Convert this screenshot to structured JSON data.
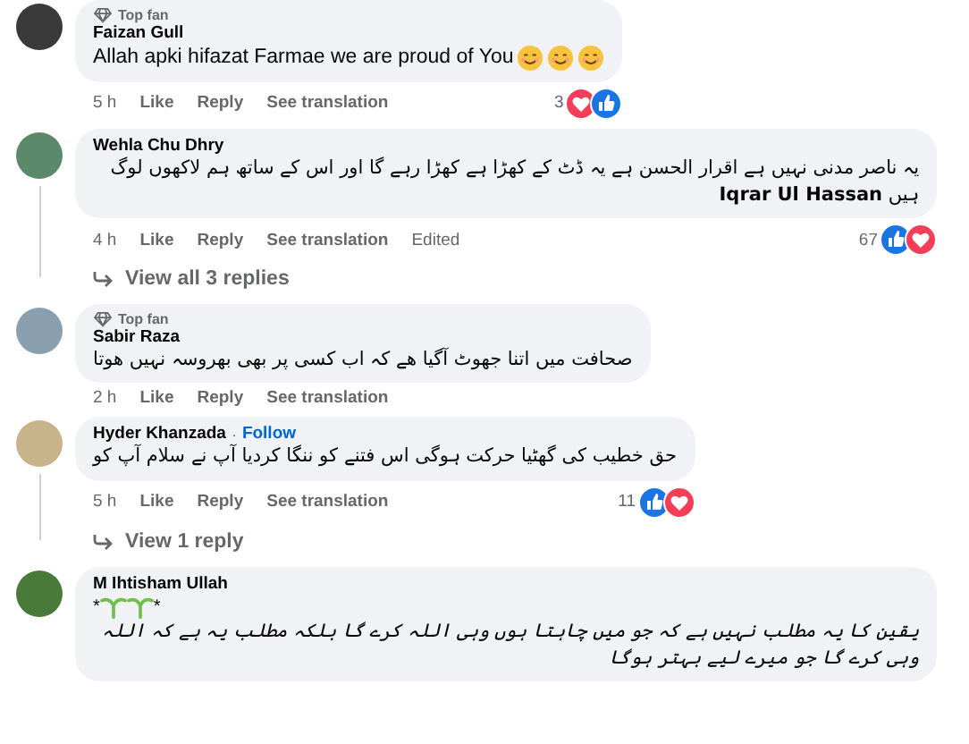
{
  "comments": [
    {
      "badge": "Top fan",
      "author": "Faizan Gull",
      "text": "Allah apki hifazat Farmae we are proud of You",
      "trailing_emoji": [
        {
          "kind": "smile"
        },
        {
          "kind": "smile"
        },
        {
          "kind": "smile"
        }
      ],
      "time": "5 h",
      "actions": [
        "Like",
        "Reply",
        "See translation"
      ],
      "reaction_count": "3",
      "reactions": [
        {
          "kind": "love"
        },
        {
          "kind": "like"
        }
      ]
    },
    {
      "author": "Wehla Chu Dhry",
      "text": "یہ ناصر مدنی نہیں ہے اقرار الحسن ہے یہ ڈٹ کے کھڑا ہے کھڑا رہے گا اور اس کے ساتھ ہم لاکھوں لوگ ہیں **Iqrar Ul Hassan**",
      "time": "4 h",
      "actions": [
        "Like",
        "Reply",
        "See translation"
      ],
      "edited": "Edited",
      "reaction_count": "67",
      "reactions": [
        {
          "kind": "like"
        },
        {
          "kind": "love"
        }
      ],
      "replies_link": "View all 3 replies"
    },
    {
      "badge": "Top fan",
      "author": "Sabir Raza",
      "text": "صحافت میں اتنا جھوٹ آگیا ھے کہ اب کسی پر بھی بھروسہ نہیں ھوتا",
      "time": "2 h",
      "actions": [
        "Like",
        "Reply",
        "See translation"
      ]
    },
    {
      "author": "Hyder Khanzada",
      "separator": "·",
      "follow": "Follow",
      "text": "حق خطیب کی گھٹیا حرکت ہوگی اس فتنے کو ننگا کردیا آپ نے سلام آپ کو",
      "time": "5 h",
      "actions": [
        "Like",
        "Reply",
        "See translation"
      ],
      "reaction_count": "11",
      "reactions": [
        {
          "kind": "like"
        },
        {
          "kind": "love"
        }
      ],
      "replies_link": "View 1 reply"
    },
    {
      "author": "M Ihtisham Ullah",
      "sprout_line": {
        "before": "*",
        "after": "*"
      },
      "text": "*یقین کا یہ مطلب نہیں ہے کہ جو میں چاہتا ہوں وہی اللہ کرے گا بلکہ مطلب یہ ہے کہ اللہ وہی کرے گا جو میرے لیے بہتر ہوگا*"
    }
  ]
}
